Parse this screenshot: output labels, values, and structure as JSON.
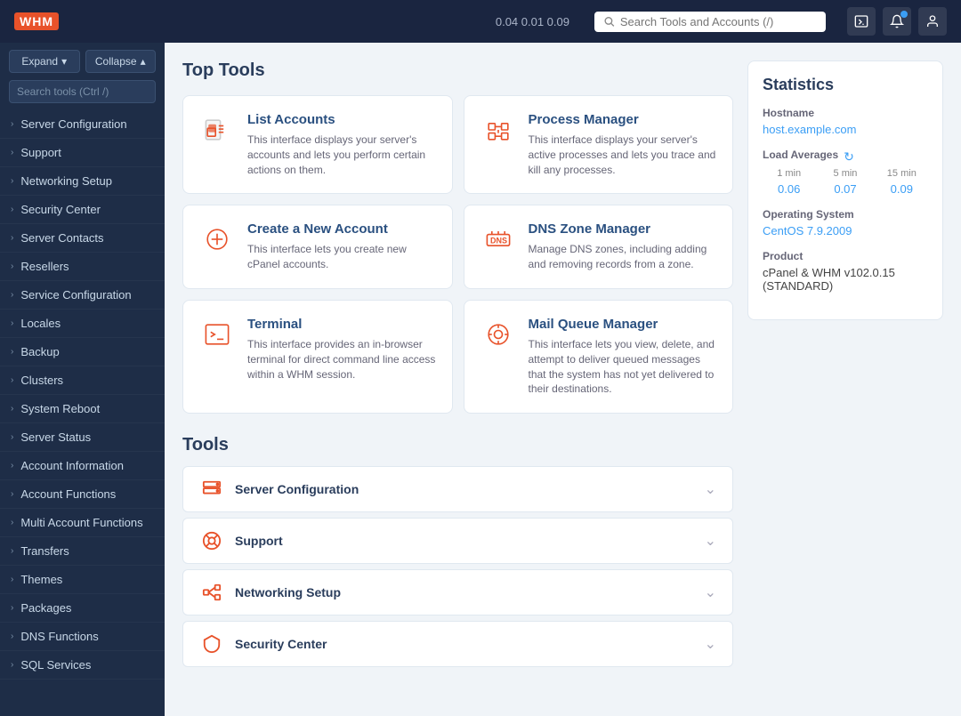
{
  "header": {
    "logo_text": "WHM",
    "load_averages": "0.04  0.01  0.09",
    "search_placeholder": "Search Tools and Accounts (/)"
  },
  "sidebar": {
    "expand_label": "Expand",
    "collapse_label": "Collapse",
    "search_placeholder": "Search tools (Ctrl /)",
    "nav_items": [
      {
        "id": "server-configuration",
        "label": "Server Configuration"
      },
      {
        "id": "support",
        "label": "Support"
      },
      {
        "id": "networking-setup",
        "label": "Networking Setup"
      },
      {
        "id": "security-center",
        "label": "Security Center"
      },
      {
        "id": "server-contacts",
        "label": "Server Contacts"
      },
      {
        "id": "resellers",
        "label": "Resellers"
      },
      {
        "id": "service-configuration",
        "label": "Service Configuration"
      },
      {
        "id": "locales",
        "label": "Locales"
      },
      {
        "id": "backup",
        "label": "Backup"
      },
      {
        "id": "clusters",
        "label": "Clusters"
      },
      {
        "id": "system-reboot",
        "label": "System Reboot"
      },
      {
        "id": "server-status",
        "label": "Server Status"
      },
      {
        "id": "account-information",
        "label": "Account Information"
      },
      {
        "id": "account-functions",
        "label": "Account Functions"
      },
      {
        "id": "multi-account-functions",
        "label": "Multi Account Functions"
      },
      {
        "id": "transfers",
        "label": "Transfers"
      },
      {
        "id": "themes",
        "label": "Themes"
      },
      {
        "id": "packages",
        "label": "Packages"
      },
      {
        "id": "dns-functions",
        "label": "DNS Functions"
      },
      {
        "id": "sql-services",
        "label": "SQL Services"
      }
    ]
  },
  "top_tools": {
    "section_title": "Top Tools",
    "tools": [
      {
        "id": "list-accounts",
        "title": "List Accounts",
        "description": "This interface displays your server's accounts and lets you perform certain actions on them."
      },
      {
        "id": "process-manager",
        "title": "Process Manager",
        "description": "This interface displays your server's active processes and lets you trace and kill any processes."
      },
      {
        "id": "create-new-account",
        "title": "Create a New Account",
        "description": "This interface lets you create new cPanel accounts."
      },
      {
        "id": "dns-zone-manager",
        "title": "DNS Zone Manager",
        "description": "Manage DNS zones, including adding and removing records from a zone."
      },
      {
        "id": "terminal",
        "title": "Terminal",
        "description": "This interface provides an in-browser terminal for direct command line access within a WHM session."
      },
      {
        "id": "mail-queue-manager",
        "title": "Mail Queue Manager",
        "description": "This interface lets you view, delete, and attempt to deliver queued messages that the system has not yet delivered to their destinations."
      }
    ]
  },
  "tools_section": {
    "section_title": "Tools",
    "rows": [
      {
        "id": "server-configuration",
        "label": "Server Configuration",
        "icon": "server"
      },
      {
        "id": "support",
        "label": "Support",
        "icon": "support"
      },
      {
        "id": "networking-setup",
        "label": "Networking Setup",
        "icon": "network"
      },
      {
        "id": "security-center",
        "label": "Security Center",
        "icon": "security"
      }
    ]
  },
  "statistics": {
    "title": "Statistics",
    "hostname_label": "Hostname",
    "hostname_value": "host.example.com",
    "load_averages_label": "Load Averages",
    "load_1min_label": "1 min",
    "load_5min_label": "5 min",
    "load_15min_label": "15 min",
    "load_1min_value": "0.06",
    "load_5min_value": "0.07",
    "load_15min_value": "0.09",
    "os_label": "Operating System",
    "os_value": "CentOS 7.9.2009",
    "product_label": "Product",
    "product_value": "cPanel & WHM v102.0.15 (STANDARD)"
  }
}
